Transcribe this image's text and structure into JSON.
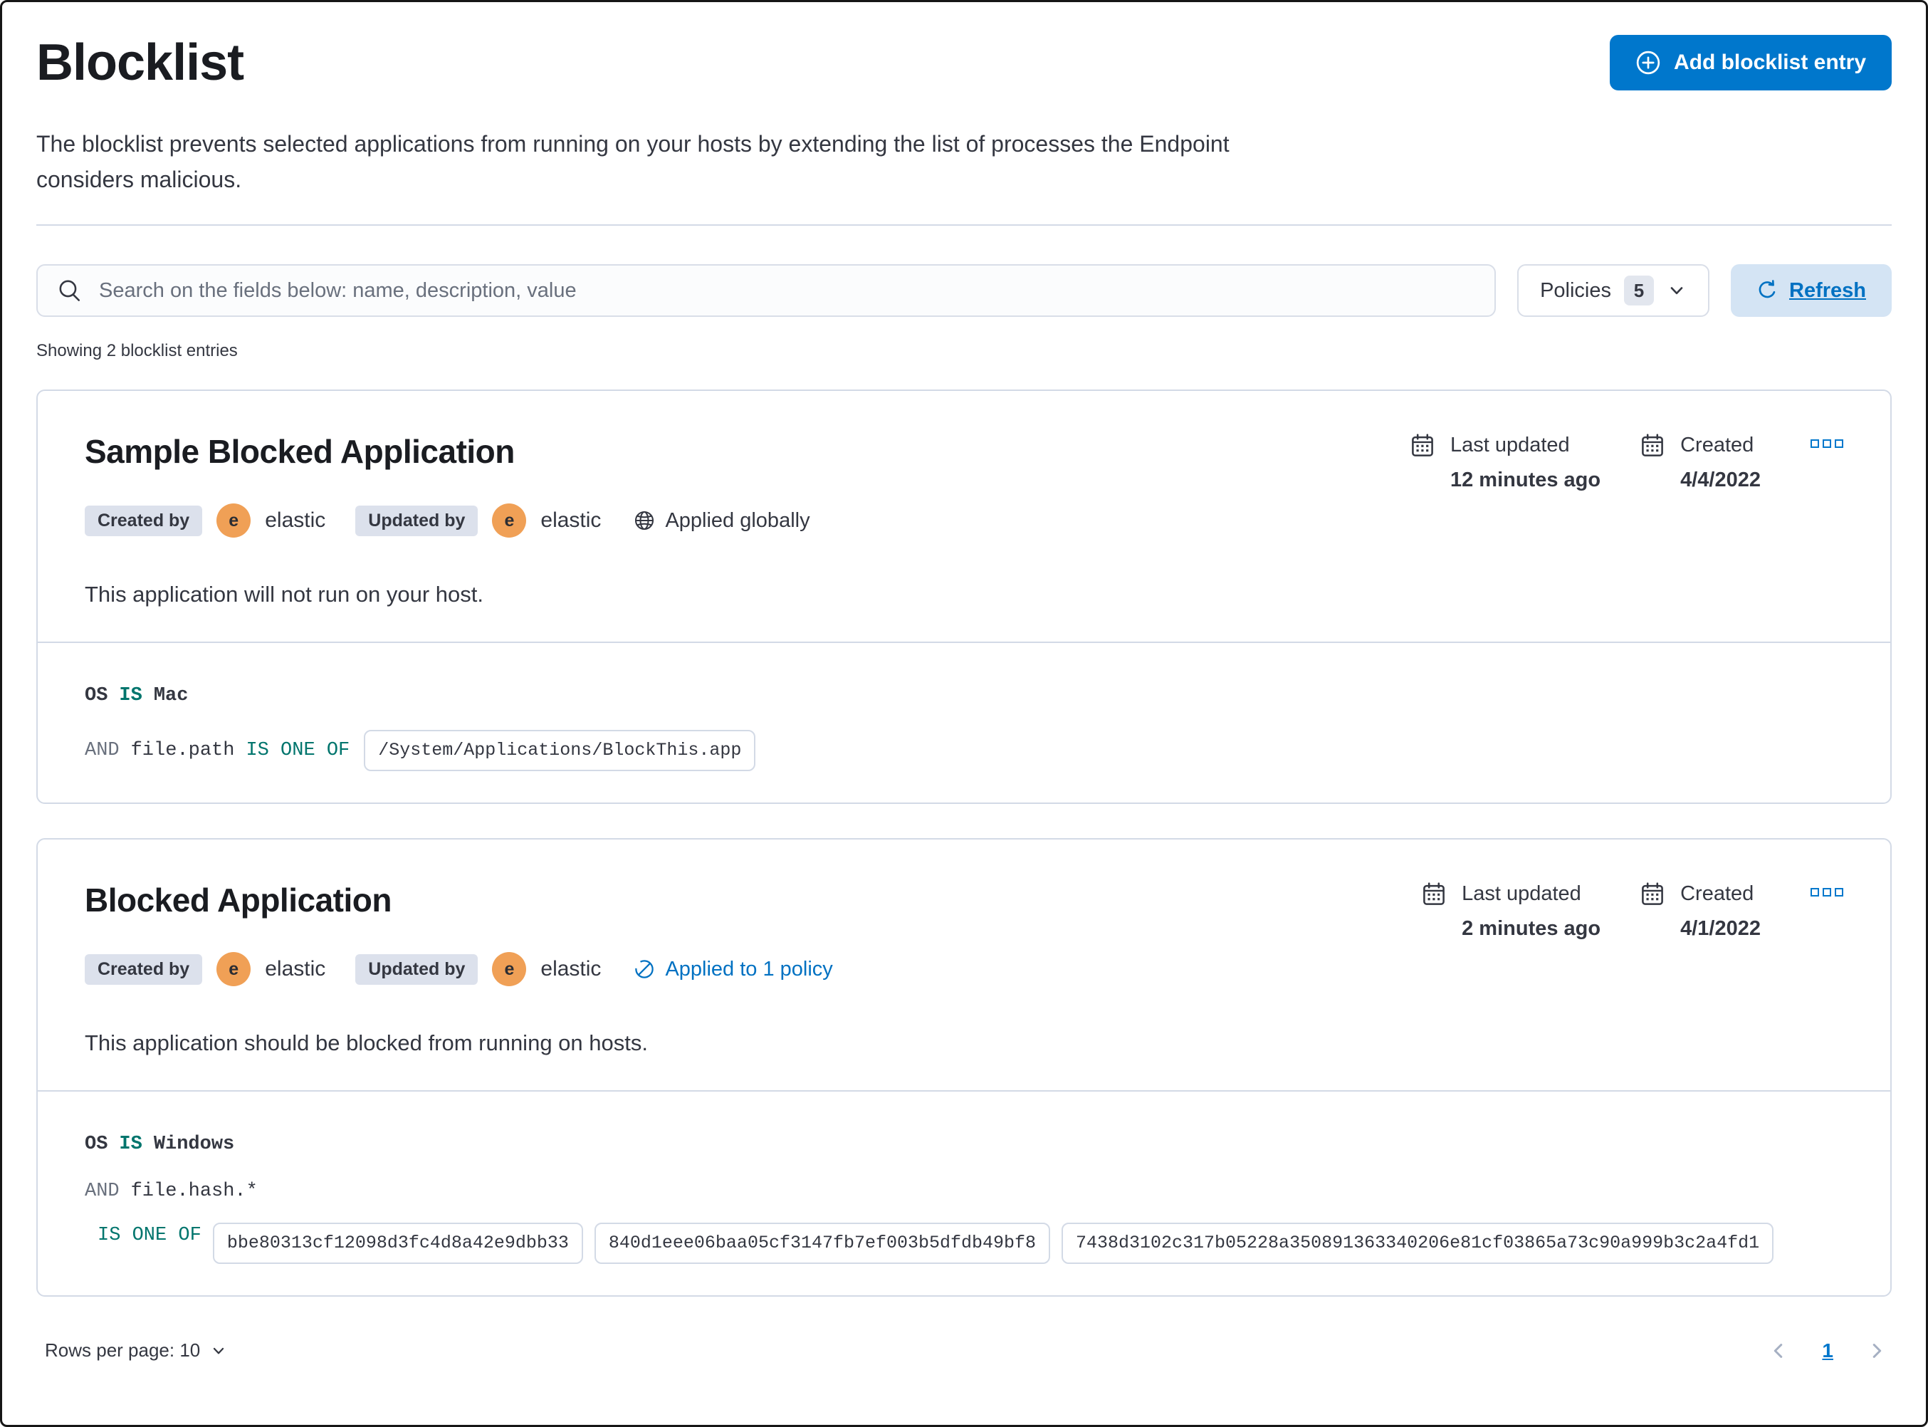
{
  "page": {
    "title": "Blocklist",
    "description": "The blocklist prevents selected applications from running on your hosts by extending the list of processes the Endpoint considers malicious.",
    "add_button_label": "Add blocklist entry",
    "search_placeholder": "Search on the fields below: name, description, value",
    "policies_label": "Policies",
    "policies_count": "5",
    "refresh_label": "Refresh",
    "showing_text": "Showing 2 blocklist entries"
  },
  "entries": [
    {
      "title": "Sample Blocked Application",
      "created_by_label": "Created by",
      "created_by_user": "elastic",
      "updated_by_label": "Updated by",
      "updated_by_user": "elastic",
      "avatar_letter": "e",
      "scope_label": "Applied globally",
      "meta": {
        "last_updated_label": "Last updated",
        "last_updated_value": "12 minutes ago",
        "created_label": "Created",
        "created_value": "4/4/2022"
      },
      "description": "This application will not run on your host.",
      "criteria": {
        "os_field": "OS",
        "os_operator": "IS",
        "os_value": "Mac",
        "condition": {
          "conjunction": "AND",
          "field": "file.path",
          "operator": "IS ONE OF",
          "values": [
            "/System/Applications/BlockThis.app"
          ]
        }
      }
    },
    {
      "title": "Blocked Application",
      "created_by_label": "Created by",
      "created_by_user": "elastic",
      "updated_by_label": "Updated by",
      "updated_by_user": "elastic",
      "avatar_letter": "e",
      "scope_label": "Applied to 1 policy",
      "meta": {
        "last_updated_label": "Last updated",
        "last_updated_value": "2 minutes ago",
        "created_label": "Created",
        "created_value": "4/1/2022"
      },
      "description": "This application should be blocked from running on hosts.",
      "criteria": {
        "os_field": "OS",
        "os_operator": "IS",
        "os_value": "Windows",
        "condition": {
          "conjunction": "AND",
          "field": "file.hash.*",
          "operator": "IS ONE OF",
          "values": [
            "bbe80313cf12098d3fc4d8a42e9dbb33",
            "840d1eee06baa05cf3147fb7ef003b5dfdb49bf8",
            "7438d3102c317b05228a350891363340206e81cf03865a73c90a999b3c2a4fd1"
          ]
        }
      }
    }
  ],
  "footer": {
    "rows_per_page_label": "Rows per page: 10",
    "page_number": "1"
  },
  "colors": {
    "primary_blue": "#0077cc",
    "link_blue": "#0071c2",
    "operator_teal": "#00756d",
    "avatar_orange": "#f0a056",
    "badge_background": "#dce1ec",
    "border_gray": "#d3dae6",
    "text_dark": "#343741"
  }
}
